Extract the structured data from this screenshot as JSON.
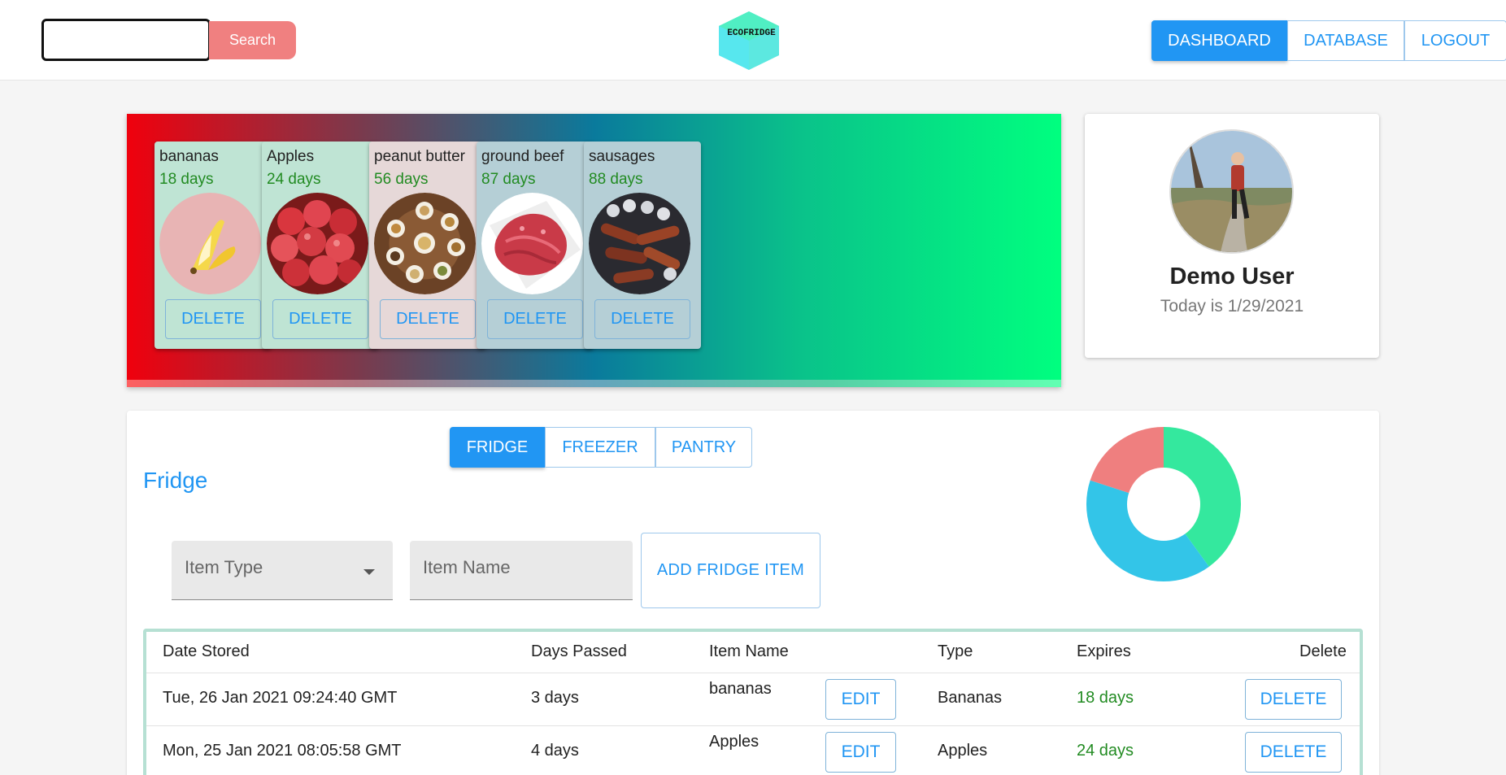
{
  "header": {
    "search_placeholder": "",
    "search_label": "Search",
    "logo_text": "ECOFRIDGE",
    "nav": [
      "DASHBOARD",
      "DATABASE",
      "LOGOUT"
    ]
  },
  "banner": {
    "items": [
      {
        "name": "bananas",
        "days": "18 days",
        "delete": "DELETE"
      },
      {
        "name": "Apples",
        "days": "24 days",
        "delete": "DELETE"
      },
      {
        "name": "peanut butter",
        "days": "56 days",
        "delete": "DELETE"
      },
      {
        "name": "ground beef",
        "days": "87 days",
        "delete": "DELETE"
      },
      {
        "name": "sausages",
        "days": "88 days",
        "delete": "DELETE"
      }
    ]
  },
  "profile": {
    "name": "Demo User",
    "date": "Today is 1/29/2021"
  },
  "storage": {
    "tabs": [
      "FRIDGE",
      "FREEZER",
      "PANTRY"
    ],
    "title": "Fridge",
    "item_type_label": "Item Type",
    "item_name_label": "Item Name",
    "add_label": "ADD FRIDGE ITEM"
  },
  "table": {
    "headers": [
      "Date Stored",
      "Days Passed",
      "Item Name",
      "Type",
      "Expires",
      "Delete"
    ],
    "rows": [
      {
        "date": "Tue, 26 Jan 2021 09:24:40 GMT",
        "passed": "3 days",
        "name": "bananas",
        "edit": "EDIT",
        "type": "Bananas",
        "expires": "18 days",
        "delete": "DELETE"
      },
      {
        "date": "Mon, 25 Jan 2021 08:05:58 GMT",
        "passed": "4 days",
        "name": "Apples",
        "edit": "EDIT",
        "type": "Apples",
        "expires": "24 days",
        "delete": "DELETE"
      }
    ]
  },
  "colors": {
    "accent": "#2196f3",
    "search_button": "#f08080",
    "expires_green": "#228b22",
    "donut_green": "#34e89e",
    "donut_blue": "#33c5e8",
    "donut_red": "#ef7f7f"
  },
  "chart_data": {
    "type": "pie",
    "title": "",
    "slices": [
      {
        "label": "",
        "value": 40,
        "color": "#34e89e"
      },
      {
        "label": "",
        "value": 40,
        "color": "#33c5e8"
      },
      {
        "label": "",
        "value": 20,
        "color": "#ef7f7f"
      }
    ]
  }
}
